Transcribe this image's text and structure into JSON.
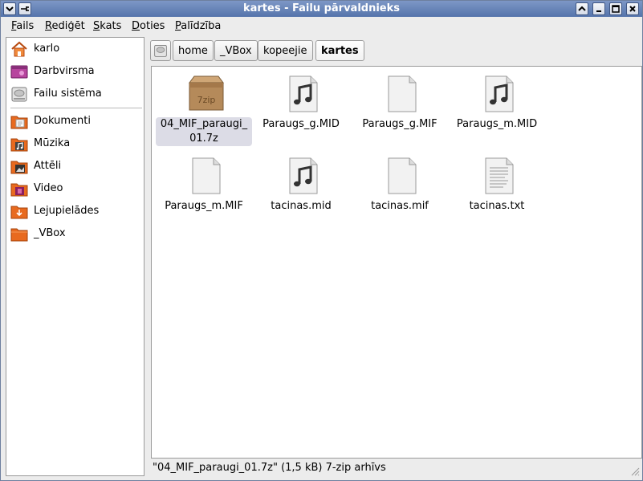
{
  "window": {
    "title": "kartes - Failu pārvaldnieks"
  },
  "menubar": {
    "items": [
      {
        "label": "Fails"
      },
      {
        "label": "Rediģēt"
      },
      {
        "label": "Skats"
      },
      {
        "label": "Doties"
      },
      {
        "label": "Palīdzība"
      }
    ]
  },
  "sidebar": {
    "items": [
      {
        "label": "karlo",
        "icon": "home-icon"
      },
      {
        "label": "Darbvirsma",
        "icon": "desktop-icon"
      },
      {
        "label": "Failu sistēma",
        "icon": "drive-icon"
      },
      {
        "label": "Dokumenti",
        "icon": "folder-documents-icon"
      },
      {
        "label": "Mūzika",
        "icon": "folder-music-icon"
      },
      {
        "label": "Attēli",
        "icon": "folder-pictures-icon"
      },
      {
        "label": "Video",
        "icon": "folder-video-icon"
      },
      {
        "label": "Lejupielādes",
        "icon": "folder-downloads-icon"
      },
      {
        "label": "_VBox",
        "icon": "folder-icon"
      }
    ]
  },
  "pathbar": {
    "segments": [
      "home",
      "_VBox",
      "kopeejie",
      "kartes"
    ],
    "root_icon": "drive-icon"
  },
  "files": [
    {
      "name_line1": "04_MIF_paraugi_",
      "name_line2": "01.7z",
      "icon": "archive-7zip-icon",
      "icon_text": "7zip",
      "selected": true
    },
    {
      "name_line1": "Paraugs_g.MID",
      "name_line2": "",
      "icon": "audio-file-icon"
    },
    {
      "name_line1": "Paraugs_g.MIF",
      "name_line2": "",
      "icon": "blank-file-icon"
    },
    {
      "name_line1": "Paraugs_m.MID",
      "name_line2": "",
      "icon": "audio-file-icon"
    },
    {
      "name_line1": "Paraugs_m.MIF",
      "name_line2": "",
      "icon": "blank-file-icon"
    },
    {
      "name_line1": "tacinas.mid",
      "name_line2": "",
      "icon": "audio-file-icon"
    },
    {
      "name_line1": "tacinas.mif",
      "name_line2": "",
      "icon": "blank-file-icon"
    },
    {
      "name_line1": "tacinas.txt",
      "name_line2": "",
      "icon": "text-file-icon"
    }
  ],
  "statusbar": {
    "text": "\"04_MIF_paraugi_01.7z\" (1,5 kB) 7-zip arhīvs"
  },
  "colors": {
    "titlebar": "#5f7db3",
    "selection": "#dcdce6",
    "folder_orange": "#e86a1f"
  }
}
